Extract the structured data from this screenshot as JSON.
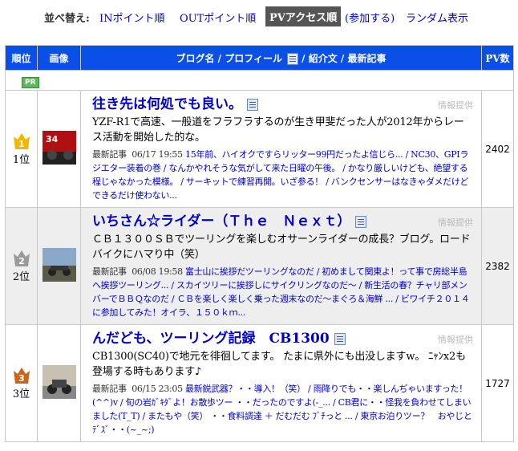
{
  "sort": {
    "label": "並べ替え:",
    "in_order": "INポイント順",
    "out_order": "OUTポイント順",
    "pv_order": "PVアクセス順",
    "join": "(参加する)",
    "random": "ランダム表示"
  },
  "header": {
    "rank": "順位",
    "image": "画像",
    "blog": "ブログ名 / プロフィール",
    "blog2": " / 紹介文 / 最新記事",
    "pv": "PV数"
  },
  "pr_label": "PR",
  "info_label": "情報提供",
  "latest_label": "最新記事",
  "rows": [
    {
      "rank": "1位",
      "medal_color": "#f4b400",
      "medal_num": "1",
      "title": "往き先は何処でも良い。",
      "desc": "YZF-R1で高速、一般道をフラフラするのが生き甲斐だった人が2012年からレース活動を開始した的な。",
      "date": "06/17 19:55",
      "articles": "15年前、ハイオクですらリッター99円だったよ信じら... / NC30、GPIラジエター装着の巻 / なんかやれそうな気がして来た日曜の午後。 / かなり厳しいけども、絶望する程じゃなかった模様。 / サーキットで練習再開。いざ参る！ / バンクセンサーはなきゃダメだけどできるだけ使わない...",
      "pv": "2402"
    },
    {
      "rank": "2位",
      "medal_color": "#9a9a9a",
      "medal_num": "2",
      "title": "いちさん☆ライダー（Ｔｈｅ　Ｎｅｘｔ）",
      "desc": "ＣＢ１３００ＳＢでツーリングを楽しむオサーンライダーの成長？ブログ。ロードバイクにハマり中（笑）",
      "date": "06/08 19:58",
      "articles": "富士山に挨拶だツーリングなのだ / 初めまして関東よ！って事で房総半島へ挨拶ツーリング... / スカイツリーに挨拶しにサイクリングなのだ～ / 新生活の春？チャリ部メンバーでＢＢＱなのだ / ＣＢを楽しく楽しく乗った週末なのだ～まぐろ＆海鮮 ... / ビワイチ２０１４に参加してみた！オイラ、１５０ｋｍ...",
      "pv": "2382"
    },
    {
      "rank": "3位",
      "medal_color": "#c8641e",
      "medal_num": "3",
      "title": "んだども、ツーリング記録　CB1300",
      "desc": "CB1300(SC40)で地元を徘徊してます。 たまに県外にも出没しますw。 ﾆｬﾝx2も登場する時もあります♪",
      "date": "06/15 23:05",
      "articles": "最新鋭武器？・・導入！（笑） / 雨降りでも・・楽しんぢゃいますった！(^^)v / 旬の岩ｶﾞｷﾀﾞよ！お散歩ツー ・・だったのですよ(-_... / CB君に・・怪我を負わせてしまいました(T_T) / またもや（笑） ・・食料調達 ＋ だむだむ ﾌﾞﾁっと ... / 東京お泊りツー？　おやじとﾃﾞｽﾞ・・(~_~;)",
      "pv": "1727"
    }
  ]
}
